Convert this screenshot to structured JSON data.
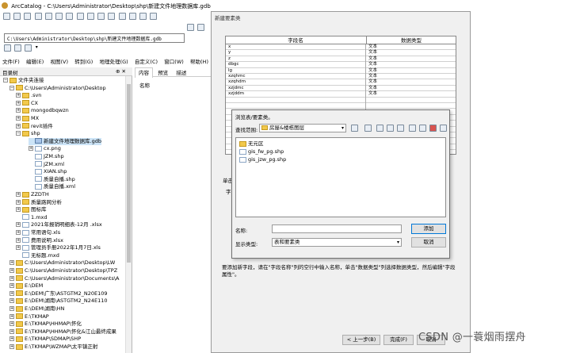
{
  "window": {
    "title": "ArcCatalog - C:\\Users\\Administrator\\Desktop\\shp\\新建文件地理数据库.gdb"
  },
  "address": {
    "value": "C:\\Users\\Administrator\\Desktop\\shp\\新建文件地理数据库.gdb"
  },
  "menu": [
    "文件(F)",
    "编辑(E)",
    "视图(V)",
    "转到(G)",
    "地理处理(G)",
    "自定义(C)",
    "窗口(W)",
    "帮助(H)"
  ],
  "tree": {
    "header": "目录树",
    "pin": "⊕ ✕",
    "items": [
      {
        "text": "文件夹连接",
        "exp": "−",
        "icon": "folder"
      },
      {
        "text": "C:\\Users\\Administrator\\Desktop",
        "exp": "−",
        "icon": "folder"
      },
      {
        "text": ".svn",
        "exp": "+",
        "icon": "folder"
      },
      {
        "text": "CX",
        "exp": "+",
        "icon": "folder"
      },
      {
        "text": "mongodbqwzn",
        "exp": "+",
        "icon": "folder"
      },
      {
        "text": "MX",
        "exp": "+",
        "icon": "folder"
      },
      {
        "text": "revit插件",
        "exp": "+",
        "icon": "folder"
      },
      {
        "text": "shp",
        "exp": "−",
        "icon": "folder"
      },
      {
        "text": "新建文件地理数据库.gdb",
        "exp": "",
        "icon": "db"
      },
      {
        "text": "cx.png",
        "exp": "+",
        "icon": "file"
      },
      {
        "text": "JZM.shp",
        "exp": "",
        "icon": "file"
      },
      {
        "text": "JZM.xml",
        "exp": "",
        "icon": "file"
      },
      {
        "text": "XIAN.shp",
        "exp": "",
        "icon": "file"
      },
      {
        "text": "质量自播.shp",
        "exp": "",
        "icon": "file"
      },
      {
        "text": "质量自播.xml",
        "exp": "",
        "icon": "file"
      },
      {
        "text": "ZZDTH",
        "exp": "+",
        "icon": "folder"
      },
      {
        "text": "质量路网分析",
        "exp": "+",
        "icon": "folder"
      },
      {
        "text": "图标库",
        "exp": "+",
        "icon": "folder"
      },
      {
        "text": "1.mxd",
        "exp": "",
        "icon": "file"
      },
      {
        "text": "2021年报销明细表-12月 .xlsx",
        "exp": "+",
        "icon": "file"
      },
      {
        "text": "常用语句.xls",
        "exp": "+",
        "icon": "file"
      },
      {
        "text": "费用说明.xlsx",
        "exp": "+",
        "icon": "file"
      },
      {
        "text": "管理员手册2022年1月7日.xls",
        "exp": "+",
        "icon": "file"
      },
      {
        "text": "无标题.mxd",
        "exp": "",
        "icon": "file"
      },
      {
        "text": "C:\\Users\\Administrator\\Desktop\\LW",
        "exp": "+",
        "icon": "folder"
      },
      {
        "text": "C:\\Users\\Administrator\\Desktop\\TPZ",
        "exp": "+",
        "icon": "folder"
      },
      {
        "text": "C:\\Users\\Administrator\\Documents\\A",
        "exp": "+",
        "icon": "folder"
      },
      {
        "text": "E:\\DEM",
        "exp": "+",
        "icon": "folder"
      },
      {
        "text": "E:\\DEM\\广东\\ASTGTM2_N20E109",
        "exp": "+",
        "icon": "folder"
      },
      {
        "text": "E:\\DEM\\湖南\\ASTGTM2_N24E110",
        "exp": "+",
        "icon": "folder"
      },
      {
        "text": "E:\\DEM\\湖南\\HN",
        "exp": "+",
        "icon": "folder"
      },
      {
        "text": "E:\\TKMAP",
        "exp": "+",
        "icon": "folder"
      },
      {
        "text": "E:\\TKMAP\\HHMAP\\怀化",
        "exp": "+",
        "icon": "folder"
      },
      {
        "text": "E:\\TKMAP\\HHMAP\\怀化&江山最终成果",
        "exp": "+",
        "icon": "folder"
      },
      {
        "text": "E:\\TKMAP\\SDMAP\\SHP",
        "exp": "+",
        "icon": "folder"
      },
      {
        "text": "E:\\TKMAP\\WZMAP\\太平镇正射",
        "exp": "+",
        "icon": "folder"
      }
    ]
  },
  "tabs": [
    {
      "label": "内容",
      "sel": true
    },
    {
      "label": "预览",
      "sel": false
    },
    {
      "label": "描述",
      "sel": false
    }
  ],
  "content_col": "名称",
  "dialog_new_table": {
    "title": "新建要素类",
    "col_field": "字段名",
    "col_type": "数据类型",
    "rows": [
      {
        "f": "x",
        "t": "文本"
      },
      {
        "f": "y",
        "t": "文本"
      },
      {
        "f": "z",
        "t": "文本"
      },
      {
        "f": "dbgc",
        "t": "文本"
      },
      {
        "f": "lg",
        "t": "文本"
      },
      {
        "f": "xzqhmc",
        "t": "文本"
      },
      {
        "f": "xzqhdm",
        "t": "文本"
      },
      {
        "f": "xzjdmc",
        "t": "文本"
      },
      {
        "f": "xzjddm",
        "t": "文本"
      },
      {
        "f": "",
        "t": ""
      },
      {
        "f": "",
        "t": ""
      },
      {
        "f": "",
        "t": ""
      },
      {
        "f": "",
        "t": ""
      },
      {
        "f": "",
        "t": ""
      },
      {
        "f": "",
        "t": ""
      },
      {
        "f": "",
        "t": ""
      },
      {
        "f": "",
        "t": ""
      },
      {
        "f": "",
        "t": ""
      },
      {
        "f": "",
        "t": ""
      }
    ],
    "side_label_1": "单击",
    "side_label_2": "字",
    "instructions": "要添加新字段，请在\"字段名称\"列的空行中输入名称，单击\"数据类型\"列选择数据类型，然后编辑\"字段属性\"。",
    "btn_back": "< 上一步(B)",
    "btn_finish": "完成(F)",
    "btn_cancel": "取消"
  },
  "dialog_browse": {
    "title": "浏览表/要素类。",
    "lookin_label": "查找范围:",
    "lookin_value": "房屋&楼栋图层",
    "files": [
      {
        "name": "无元区",
        "icon": "folder"
      },
      {
        "name": "gis_fw_pg.shp",
        "icon": "file"
      },
      {
        "name": "gis_jzw_pg.shp",
        "icon": "file"
      }
    ],
    "name_label": "名称:",
    "name_value": "",
    "type_label": "显示类型:",
    "type_value": "表和要素类",
    "btn_add": "添加",
    "btn_cancel": "取消"
  },
  "watermark": "CSDN @一蓑烟雨摆舟"
}
